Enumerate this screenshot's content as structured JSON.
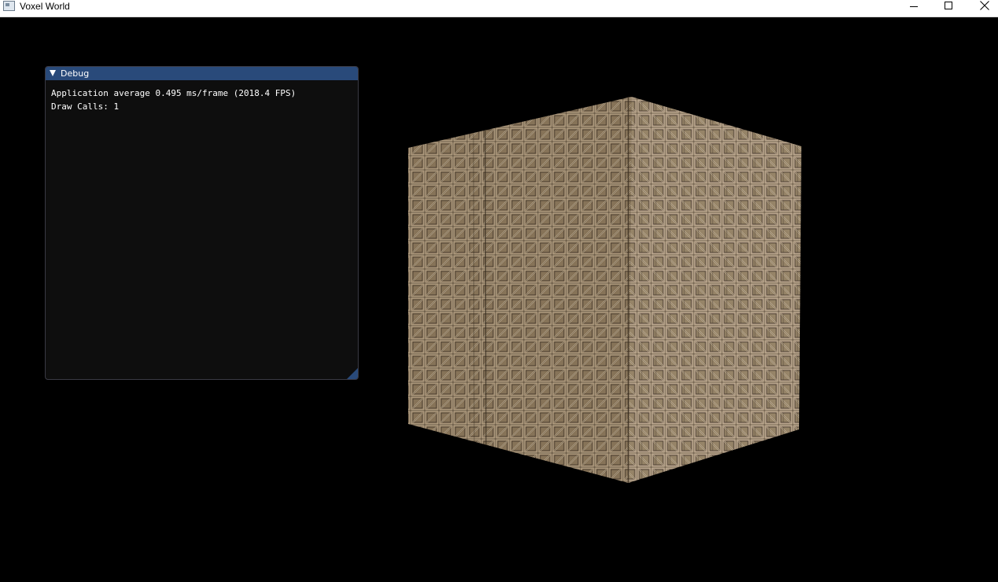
{
  "window": {
    "title": "Voxel World",
    "controls": {
      "minimize_icon": "minimize-icon",
      "maximize_icon": "maximize-icon",
      "close_icon": "close-icon"
    }
  },
  "debug_panel": {
    "title": "Debug",
    "collapse_icon": "triangle-down-icon",
    "lines": [
      "Application average 0.495 ms/frame (2018.4 FPS)",
      "Draw Calls: 1"
    ]
  },
  "scene": {
    "object": "voxel-cube",
    "texture": "wooden-crate",
    "colors": {
      "background": "#000000",
      "crate_base": "#9e8a6e",
      "crate_light": "#bca98c",
      "crate_dark": "#3b2f22",
      "imgui_title": "#294a7a",
      "imgui_bg": "#0f0f0f"
    }
  }
}
